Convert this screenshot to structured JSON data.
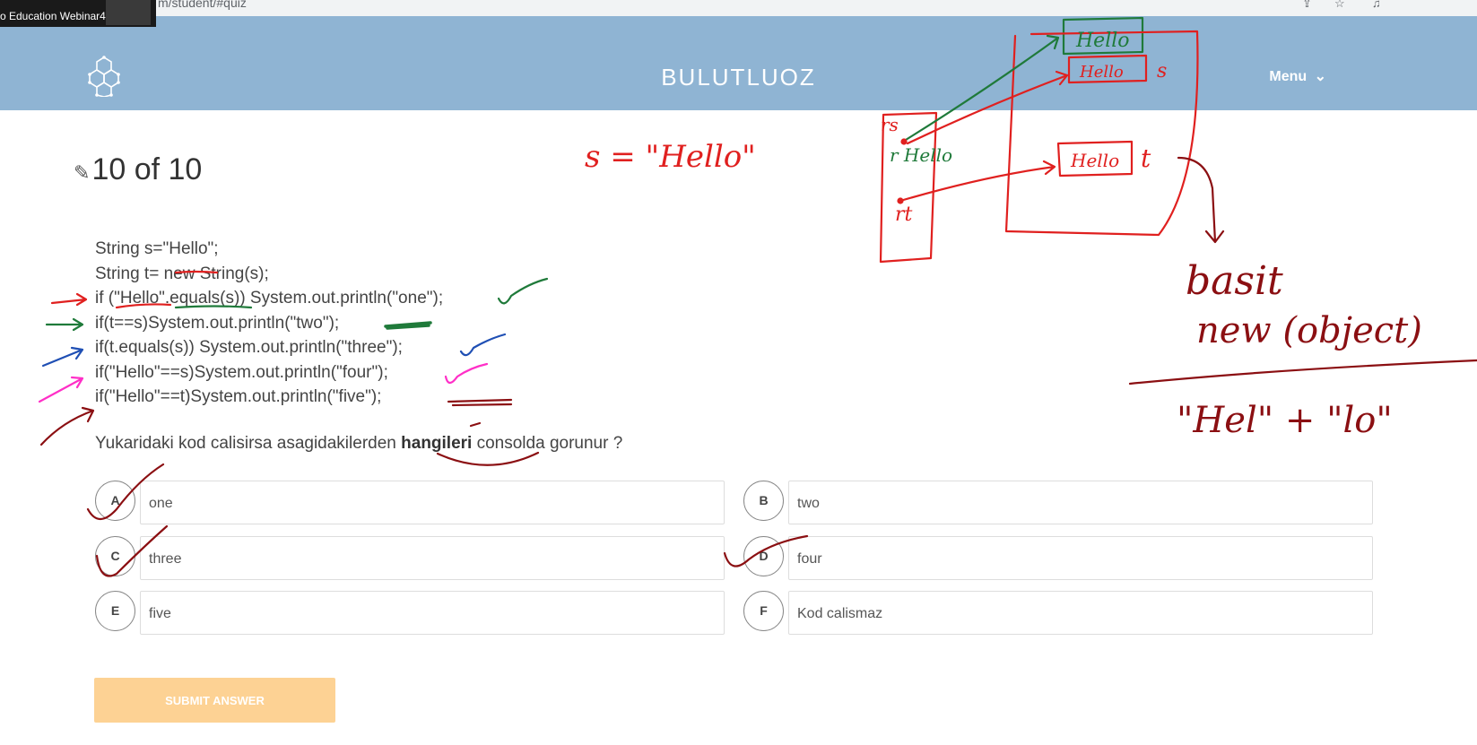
{
  "browser": {
    "url": "m/student/#quiz"
  },
  "webinar": {
    "title": "o Education Webinar4"
  },
  "header": {
    "brand": "BULUTLUOZ",
    "menu_label": "Menu"
  },
  "quiz": {
    "counter": "10 of 10",
    "code_lines": [
      "String s=\"Hello\";",
      "String t= new String(s);",
      "if (\"Hello\".equals(s)) System.out.println(\"one\");",
      "if(t==s)System.out.println(\"two\");",
      "if(t.equals(s)) System.out.println(\"three\");",
      "if(\"Hello\"==s)System.out.println(\"four\");",
      "if(\"Hello\"==t)System.out.println(\"five\");"
    ],
    "question_before": "Yukaridaki kod calisirsa asagidakilerden ",
    "question_bold": "hangileri",
    "question_after": " consolda gorunur ?",
    "options": [
      {
        "letter": "A",
        "text": "one"
      },
      {
        "letter": "B",
        "text": "two"
      },
      {
        "letter": "C",
        "text": "three"
      },
      {
        "letter": "D",
        "text": "four"
      },
      {
        "letter": "E",
        "text": "five"
      },
      {
        "letter": "F",
        "text": "Kod calismaz"
      }
    ],
    "submit_label": "SUBMIT ANSWER"
  },
  "annotations": {
    "s_assign": "s = \"Hello\"",
    "rs": "rs",
    "r_hello": "r Hello",
    "rt": "rt",
    "box_top": "Hello",
    "box_mid": "Hello",
    "box_mid_var": "s",
    "box_low": "Hello",
    "box_low_var": "t",
    "basit": "basit",
    "new_object": "new (object)",
    "concat": "\"Hel\" + \"lo\"",
    "colors": {
      "red": "#e0201f",
      "green": "#1f7a3a",
      "blue": "#1f4fb4",
      "pink": "#ff2fc7",
      "maroon": "#8b0f12"
    }
  }
}
